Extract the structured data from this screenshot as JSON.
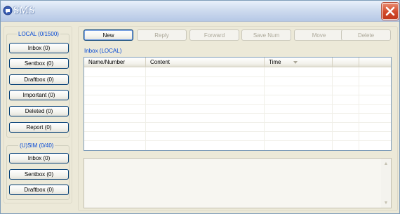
{
  "window": {
    "title": "SMS"
  },
  "title_icon": "sms-app-icon",
  "close_icon": "close-x-icon",
  "local": {
    "label": "LOCAL (0/1500)",
    "items": [
      {
        "label": "Inbox (0)"
      },
      {
        "label": "Sentbox (0)"
      },
      {
        "label": "Draftbox (0)"
      },
      {
        "label": "Important (0)"
      },
      {
        "label": "Deleted (0)"
      },
      {
        "label": "Report (0)"
      }
    ]
  },
  "sim": {
    "label": "(U)SIM (0/40)",
    "items": [
      {
        "label": "Inbox (0)"
      },
      {
        "label": "Sentbox (0)"
      },
      {
        "label": "Draftbox (0)"
      }
    ]
  },
  "toolbar": {
    "new": "New",
    "reply": "Reply",
    "forward": "Forward",
    "save_num": "Save Num",
    "move": "Move",
    "delete": "Delete"
  },
  "inbox": {
    "label": "Inbox (LOCAL)",
    "columns": [
      "Name/Number",
      "Content",
      "Time"
    ],
    "sort_icon": "sort-descending-icon"
  },
  "colors": {
    "window_bg": "#ece9d8",
    "group_label": "#0046d5",
    "button_border": "#003c74",
    "close_button": "#d24a2b"
  }
}
